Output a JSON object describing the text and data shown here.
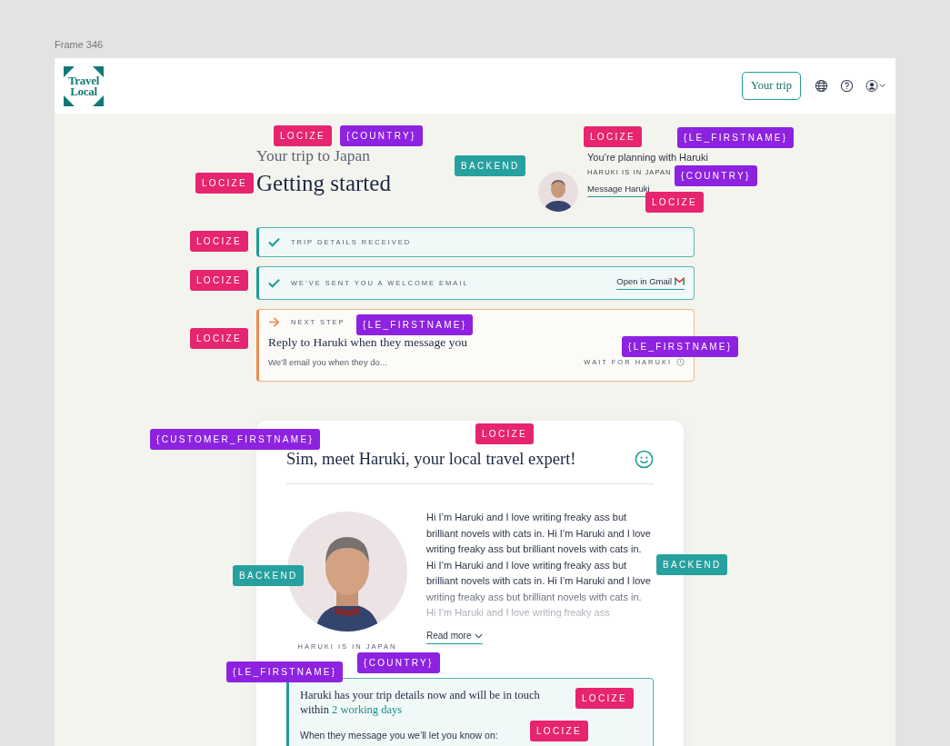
{
  "frame_label": "Frame 346",
  "header": {
    "logo": [
      "Travel",
      "Local"
    ],
    "trip_button": "Your trip"
  },
  "hero": {
    "subtitle": "Your trip to Japan",
    "title": "Getting started"
  },
  "planner": {
    "line": "You’re planning with Haruki",
    "location": "HARUKI IS IN JAPAN",
    "link": "Message Haruki"
  },
  "steps": [
    {
      "kind": "done",
      "label": "TRIP DETAILS RECEIVED"
    },
    {
      "kind": "done",
      "label": "WE’VE SENT YOU A WELCOME EMAIL",
      "link": "Open in Gmail"
    },
    {
      "kind": "next",
      "label": "NEXT STEP",
      "title": "Reply to Haruki when they message you",
      "note": "We’ll email you when they do...",
      "status": "WAIT FOR HARUKI"
    }
  ],
  "expert_card": {
    "title": "Sim, meet Haruki, your local travel expert!",
    "location": "HARUKI IS IN JAPAN",
    "bio": "Hi I’m Haruki and I love writing freaky ass but brilliant novels with cats in. Hi I’m Haruki and I love writing freaky ass but brilliant novels with cats in. Hi I’m Haruki and I love writing freaky ass but brilliant novels with cats in. Hi I’m Haruki and I love writing freaky ass but brilliant novels with cats in. Hi I’m Haruki and I love writing freaky ass",
    "read_more": "Read more",
    "notice": {
      "text": "Haruki has your trip details now and will be in touch within ",
      "highlight": "2 working days",
      "note": "When they message you we’ll let you know on:"
    }
  },
  "tags": [
    {
      "kind": "locize",
      "text": "LOCIZE"
    },
    {
      "kind": "variable",
      "text": "{COUNTRY}"
    },
    {
      "kind": "locize",
      "text": "LOCIZE"
    },
    {
      "kind": "backend",
      "text": "BACKEND"
    },
    {
      "kind": "locize",
      "text": "LOCIZE"
    },
    {
      "kind": "variable",
      "text": "{LE_FIRSTNAME}"
    },
    {
      "kind": "variable",
      "text": "{COUNTRY}"
    },
    {
      "kind": "locize",
      "text": "LOCIZE"
    },
    {
      "kind": "locize",
      "text": "LOCIZE"
    },
    {
      "kind": "locize",
      "text": "LOCIZE"
    },
    {
      "kind": "locize",
      "text": "LOCIZE"
    },
    {
      "kind": "variable",
      "text": "{LE_FIRSTNAME}"
    },
    {
      "kind": "variable",
      "text": "{LE_FIRSTNAME}"
    },
    {
      "kind": "variable",
      "text": "{CUSTOMER_FIRSTNAME}"
    },
    {
      "kind": "locize",
      "text": "LOCIZE"
    },
    {
      "kind": "backend",
      "text": "BACKEND"
    },
    {
      "kind": "backend",
      "text": "BACKEND"
    },
    {
      "kind": "variable",
      "text": "{COUNTRY}"
    },
    {
      "kind": "variable",
      "text": "{LE_FIRSTNAME}"
    },
    {
      "kind": "locize",
      "text": "LOCIZE"
    },
    {
      "kind": "locize",
      "text": "LOCIZE"
    }
  ]
}
